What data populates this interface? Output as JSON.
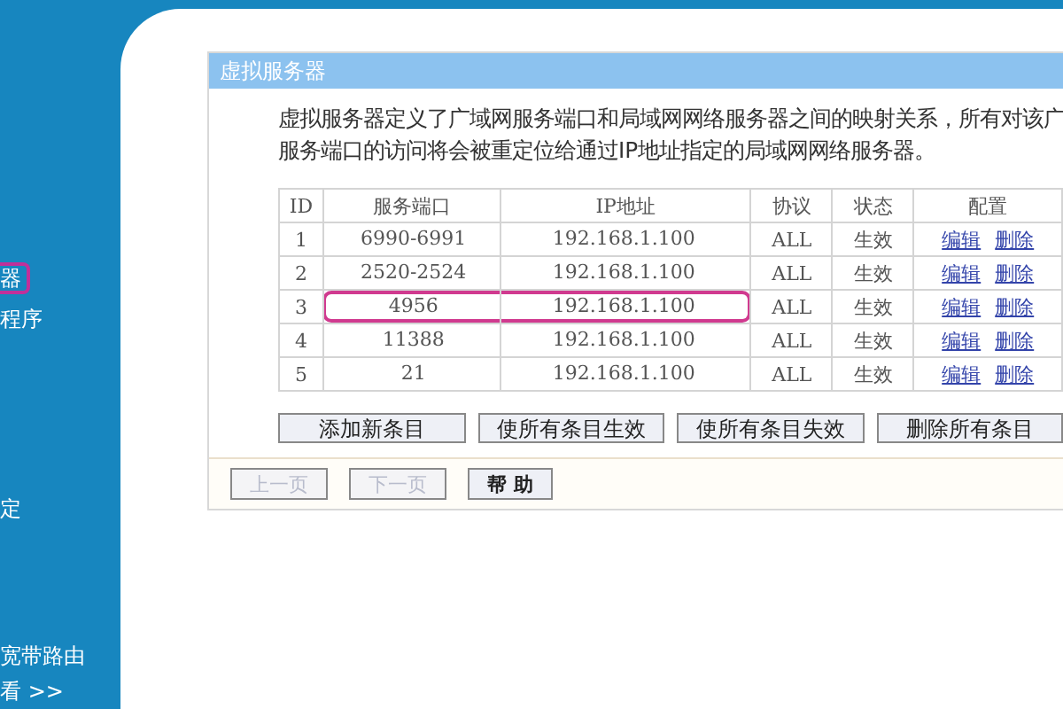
{
  "sidebar": {
    "items": [
      {
        "label": "器",
        "selected": true
      },
      {
        "label": "程序",
        "selected": false
      },
      {
        "label": "定",
        "selected": false
      },
      {
        "label": "宽带路由",
        "selected": false
      },
      {
        "label": "看 >>",
        "selected": false
      }
    ]
  },
  "panel": {
    "title": "虚拟服务器",
    "description": [
      "虚拟服务器定义了广域网服务端口和局域网网络服务器之间的映射关系，所有对该广",
      "服务端口的访问将会被重定位给通过IP地址指定的局域网网络服务器。"
    ],
    "table": {
      "columns": [
        "ID",
        "服务端口",
        "IP地址",
        "协议",
        "状态",
        "配置"
      ],
      "rows": [
        {
          "id": "1",
          "port": "6990-6991",
          "ip": "192.168.1.100",
          "protocol": "ALL",
          "status": "生效",
          "edit": "编辑",
          "delete": "删除",
          "highlighted": false
        },
        {
          "id": "2",
          "port": "2520-2524",
          "ip": "192.168.1.100",
          "protocol": "ALL",
          "status": "生效",
          "edit": "编辑",
          "delete": "删除",
          "highlighted": false
        },
        {
          "id": "3",
          "port": "4956",
          "ip": "192.168.1.100",
          "protocol": "ALL",
          "status": "生效",
          "edit": "编辑",
          "delete": "删除",
          "highlighted": true
        },
        {
          "id": "4",
          "port": "11388",
          "ip": "192.168.1.100",
          "protocol": "ALL",
          "status": "生效",
          "edit": "编辑",
          "delete": "删除",
          "highlighted": false
        },
        {
          "id": "5",
          "port": "21",
          "ip": "192.168.1.100",
          "protocol": "ALL",
          "status": "生效",
          "edit": "编辑",
          "delete": "删除",
          "highlighted": false
        }
      ]
    },
    "actions": [
      "添加新条目",
      "使所有条目生效",
      "使所有条目失效",
      "删除所有条目"
    ],
    "nav": [
      {
        "label": "上一页",
        "disabled": true
      },
      {
        "label": "下一页",
        "disabled": true
      },
      {
        "label": "帮 助",
        "disabled": false
      }
    ]
  }
}
